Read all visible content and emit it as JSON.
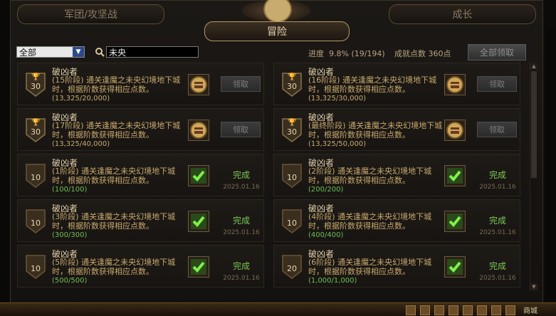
{
  "tabs": {
    "left": "军团/攻坚战",
    "active": "冒险",
    "right": "成长"
  },
  "toolbar": {
    "filter_value": "全部",
    "search_value": "未央",
    "progress_label": "进度",
    "progress_value": "9.8% (19/194)",
    "points_label": "成就点数",
    "points_value": "360点",
    "claim_all_label": "全部领取"
  },
  "achievements": [
    {
      "title": "破凶者",
      "desc": "(15阶段) 通关逢魔之未央幻境地下城时，根据阶数获得相应点数。",
      "progress": "(13,325/20,000)",
      "points": "30",
      "status": "claim",
      "action": "领取",
      "completed": false
    },
    {
      "title": "破凶者",
      "desc": "(16阶段) 通关逢魔之未央幻境地下城时，根据阶数获得相应点数。",
      "progress": "(13,325/30,000)",
      "points": "30",
      "status": "claim",
      "action": "领取",
      "completed": false
    },
    {
      "title": "破凶者",
      "desc": "(17阶段) 通关逢魔之未央幻境地下城时，根据阶数获得相应点数。",
      "progress": "(13,325/40,000)",
      "points": "30",
      "status": "claim",
      "action": "领取",
      "completed": false
    },
    {
      "title": "破凶者",
      "desc": "(最终阶段) 通关逢魔之未央幻境地下城时，根据阶数获得相应点数。",
      "progress": "(13,325/50,000)",
      "points": "30",
      "status": "claim",
      "action": "领取",
      "completed": false
    },
    {
      "title": "破凶者",
      "desc": "(1阶段) 通关逢魔之未央幻境地下城时，根据阶数获得相应点数。",
      "progress": "(100/100)",
      "points": "10",
      "status": "done",
      "action": "完成",
      "date": "2025.01.16",
      "completed": true
    },
    {
      "title": "破凶者",
      "desc": "(2阶段) 通关逢魔之未央幻境地下城时，根据阶数获得相应点数。",
      "progress": "(200/200)",
      "points": "10",
      "status": "done",
      "action": "完成",
      "date": "2025.01.16",
      "completed": true
    },
    {
      "title": "破凶者",
      "desc": "(3阶段) 通关逢魔之未央幻境地下城时，根据阶数获得相应点数。",
      "progress": "(300/300)",
      "points": "10",
      "status": "done",
      "action": "完成",
      "date": "2025.01.16",
      "completed": true
    },
    {
      "title": "破凶者",
      "desc": "(4阶段) 通关逢魔之未央幻境地下城时，根据阶数获得相应点数。",
      "progress": "(400/400)",
      "points": "10",
      "status": "done",
      "action": "完成",
      "date": "2025.01.16",
      "completed": true
    },
    {
      "title": "破凶者",
      "desc": "(5阶段) 通关逢魔之未央幻境地下城时，根据阶数获得相应点数。",
      "progress": "(500/500)",
      "points": "10",
      "status": "done",
      "action": "完成",
      "date": "2025.01.16",
      "completed": true
    },
    {
      "title": "破凶者",
      "desc": "(6阶段) 通关逢魔之未央幻境地下城时，根据阶数获得相应点数。",
      "progress": "(1,000/1,000)",
      "points": "20",
      "status": "done",
      "action": "完成",
      "date": "2025.01.16",
      "completed": true
    }
  ],
  "taskbar": {
    "shop_label": "商城"
  },
  "colors": {
    "accent_gold": "#c9a96e",
    "complete_green": "#7ec857"
  }
}
